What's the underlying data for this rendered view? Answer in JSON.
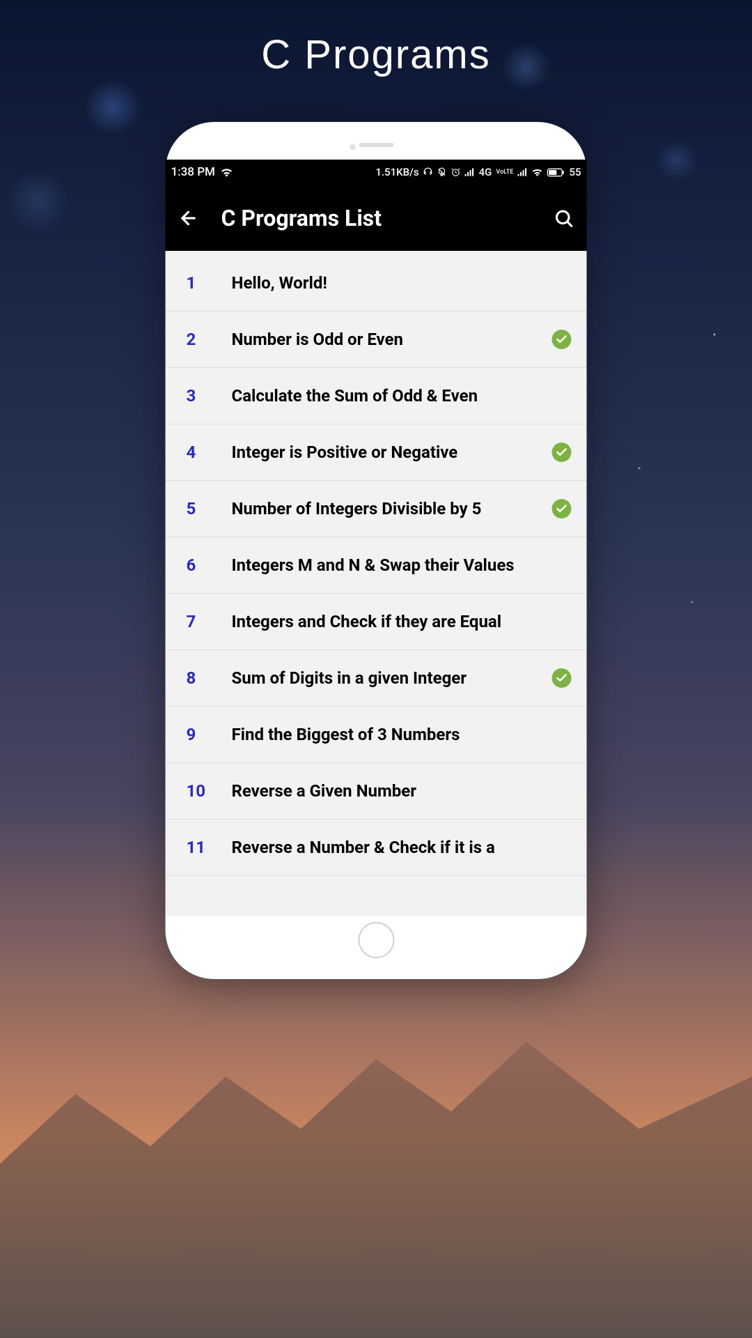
{
  "page_heading": "C Programs",
  "status_bar": {
    "time": "1:38 PM",
    "data_rate": "1.51KB/s",
    "network_label": "4G",
    "volte_label": "VoLTE",
    "battery": "55"
  },
  "app_bar": {
    "title": "C Programs List"
  },
  "programs": [
    {
      "number": "1",
      "title": "Hello, World!",
      "completed": false
    },
    {
      "number": "2",
      "title": "Number is Odd or Even",
      "completed": true
    },
    {
      "number": "3",
      "title": "Calculate the Sum of Odd & Even",
      "completed": false
    },
    {
      "number": "4",
      "title": "Integer is Positive or Negative",
      "completed": true
    },
    {
      "number": "5",
      "title": "Number of Integers Divisible by 5",
      "completed": true
    },
    {
      "number": "6",
      "title": "Integers M and N & Swap their Values",
      "completed": false
    },
    {
      "number": "7",
      "title": "Integers and Check if they are Equal",
      "completed": false
    },
    {
      "number": "8",
      "title": "Sum of Digits in a given Integer",
      "completed": true
    },
    {
      "number": "9",
      "title": "Find the Biggest of 3 Numbers",
      "completed": false
    },
    {
      "number": "10",
      "title": "Reverse a Given Number",
      "completed": false
    },
    {
      "number": "11",
      "title": "Reverse a Number & Check if it is a",
      "completed": false
    }
  ]
}
